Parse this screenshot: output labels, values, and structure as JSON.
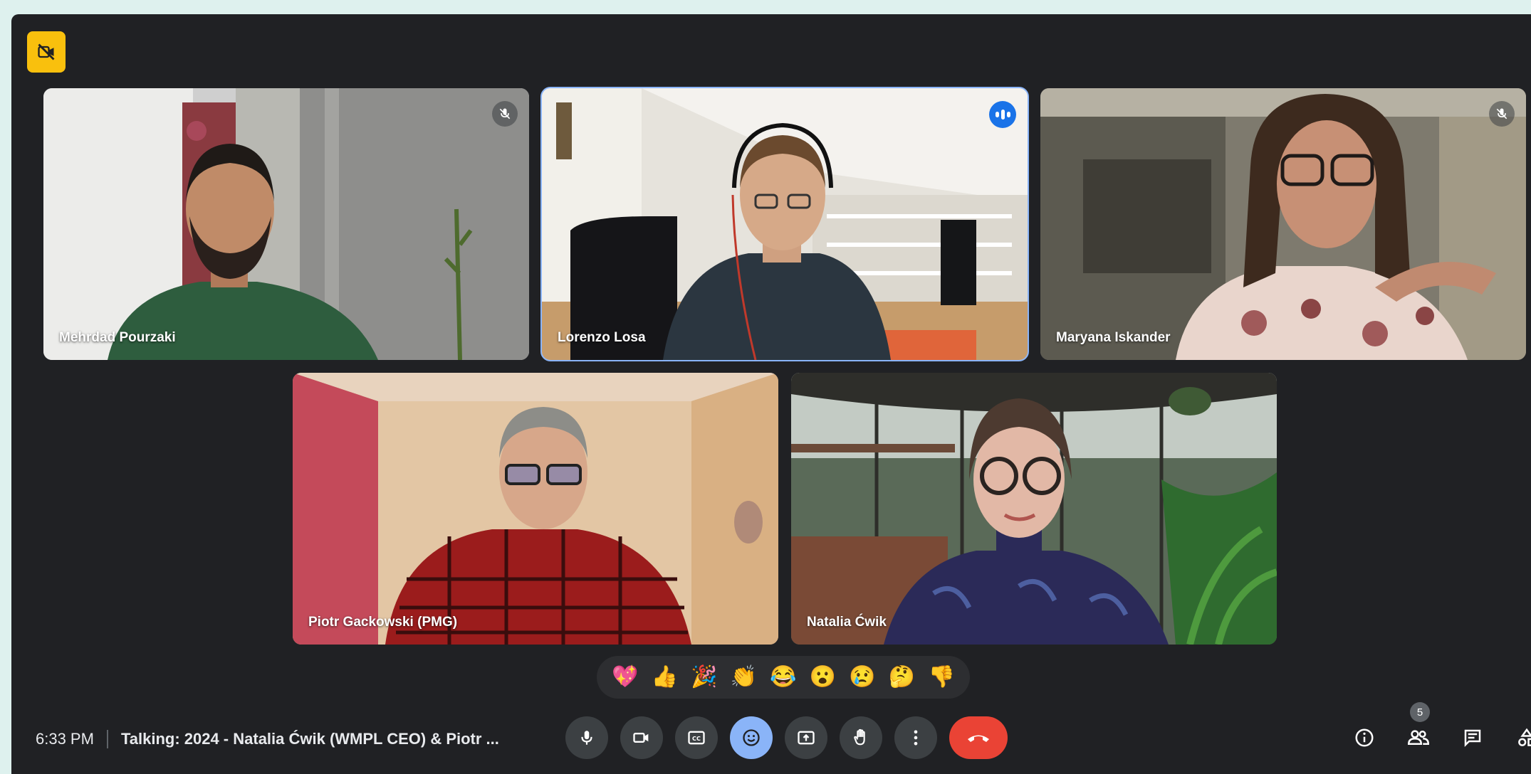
{
  "participants": [
    {
      "name": "Mehrdad Pourzaki",
      "muted": true,
      "speaking": false
    },
    {
      "name": "Lorenzo Losa",
      "muted": false,
      "speaking": true
    },
    {
      "name": "Maryana Iskander",
      "muted": true,
      "speaking": false
    },
    {
      "name": "Piotr Gackowski (PMG)",
      "muted": false,
      "speaking": false
    },
    {
      "name": "Natalia Ćwik",
      "muted": false,
      "speaking": false
    }
  ],
  "reactions": [
    "💖",
    "👍",
    "🎉",
    "👏",
    "😂",
    "😮",
    "😢",
    "🤔",
    "👎"
  ],
  "status": {
    "time": "6:33 PM",
    "meeting_title": "Talking: 2024 - Natalia Ćwik (WMPL CEO) & Piotr ..."
  },
  "controls": [
    "microphone-icon",
    "camera-icon",
    "captions-icon",
    "emoji-icon",
    "present-icon",
    "raise-hand-icon",
    "more-options-icon",
    "hang-up-icon"
  ],
  "side_panel": {
    "people_count": "5"
  },
  "colors": {
    "accent": "#8ab4f8",
    "hangup": "#ea4335",
    "badge": "#f9c00d",
    "background": "#202124"
  }
}
